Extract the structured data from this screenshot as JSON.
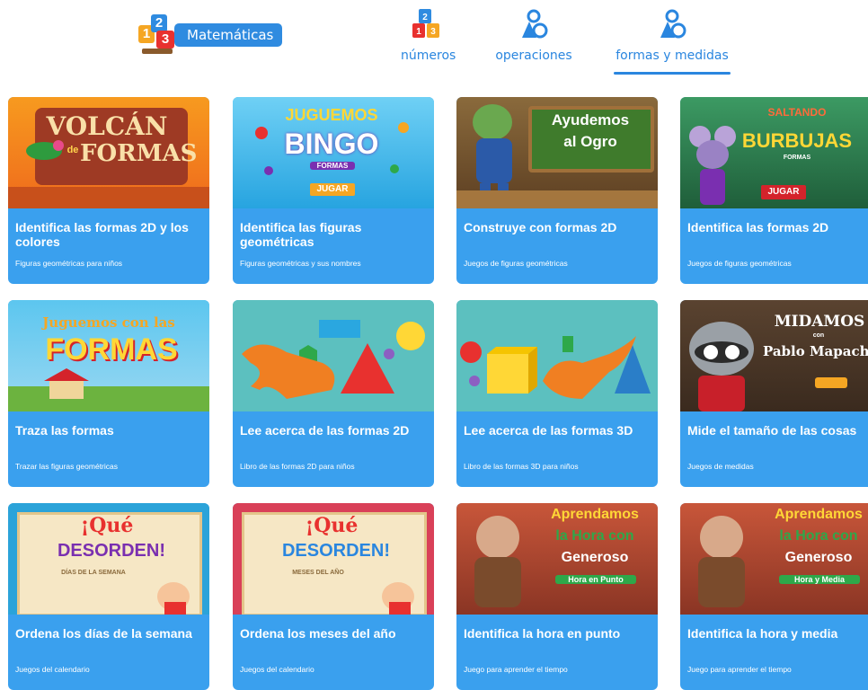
{
  "header": {
    "logo": {
      "digits": [
        "1",
        "2",
        "3"
      ],
      "label": "Matemáticas"
    },
    "nav": [
      {
        "label": "números",
        "icon": "number-blocks-icon",
        "active": false
      },
      {
        "label": "operaciones",
        "icon": "shapes-icon",
        "active": false
      },
      {
        "label": "formas y medidas",
        "icon": "shapes-icon",
        "active": true
      }
    ],
    "accent": "#2a86df"
  },
  "cards": [
    {
      "title": "Identifica las formas 2D y los colores",
      "subtitle": "Figuras geométricas para niños",
      "thumb": {
        "lines": [
          "VOLCÁN",
          "FORMAS"
        ],
        "small": "de",
        "bg": "#f47d1f"
      }
    },
    {
      "title": "Identifica las figuras geométricas",
      "subtitle": "Figuras geométricas y sus nombres",
      "thumb": {
        "lines": [
          "JUGUEMOS",
          "BINGO"
        ],
        "small": "FORMAS",
        "button": "JUGAR",
        "bg": "#43b8e8"
      }
    },
    {
      "title": "Construye con formas 2D",
      "subtitle": "Juegos de figuras geométricas",
      "thumb": {
        "lines": [
          "Ayudemos",
          "al Ogro"
        ],
        "bg": "#7a5530"
      }
    },
    {
      "title": "Identifica las formas 2D",
      "subtitle": "Juegos de figuras geométricas",
      "thumb": {
        "lines": [
          "SALTANDO",
          "BURBUJAS"
        ],
        "small": "FORMAS",
        "button": "JUGAR",
        "bg": "#2c7a50"
      }
    },
    {
      "title": "Traza las formas",
      "subtitle": "Trazar las figuras geométricas",
      "thumb": {
        "lines": [
          "Juguemos con las",
          "FORMAS"
        ],
        "bg": "#43b8e8"
      }
    },
    {
      "title": "Lee acerca de las formas 2D",
      "subtitle": "Libro de las formas 2D para niños",
      "thumb": {
        "lines": [],
        "bg": "#5cc0bf"
      }
    },
    {
      "title": "Lee acerca de las formas 3D",
      "subtitle": "Libro de las formas 3D para niños",
      "thumb": {
        "lines": [],
        "bg": "#5cc0bf"
      }
    },
    {
      "title": "Mide el tamaño de las cosas",
      "subtitle": "Juegos de medidas",
      "thumb": {
        "lines": [
          "MIDAMOS",
          "Pablo Mapache"
        ],
        "small": "con",
        "bg": "#4a3526"
      }
    },
    {
      "title": "Ordena los días de la semana",
      "subtitle": "Juegos del calendario",
      "thumb": {
        "lines": [
          "¡Qué",
          "DESORDEN!"
        ],
        "small": "DÍAS DE LA SEMANA",
        "bg": "#2ba3d9"
      }
    },
    {
      "title": "Ordena los meses del año",
      "subtitle": "Juegos del calendario",
      "thumb": {
        "lines": [
          "¡Qué",
          "DESORDEN!"
        ],
        "small": "MESES DEL AÑO",
        "bg": "#d94058"
      }
    },
    {
      "title": "Identifica la hora en punto",
      "subtitle": "Juego para aprender el tiempo",
      "thumb": {
        "lines": [
          "Aprendamos",
          "la Hora con",
          "Generoso"
        ],
        "small": "Hora en Punto",
        "bg": "#b7442c"
      }
    },
    {
      "title": "Identifica la hora y media",
      "subtitle": "Juego para aprender el tiempo",
      "thumb": {
        "lines": [
          "Aprendamos",
          "la Hora con",
          "Generoso"
        ],
        "small": "Hora y Media",
        "bg": "#b7442c"
      }
    }
  ]
}
